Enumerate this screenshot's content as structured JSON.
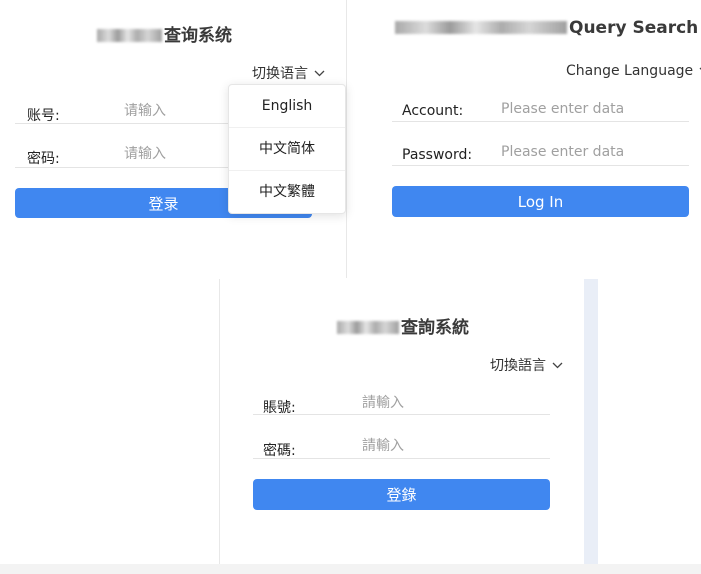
{
  "panel_cn_simplified": {
    "title_visible": "查询系统",
    "language_switch": "切换语言",
    "account_label": "账号:",
    "account_placeholder": "请输入",
    "password_label": "密码:",
    "password_placeholder": "请输入",
    "login_button": "登录",
    "language_menu": [
      "English",
      "中文简体",
      "中文繁體"
    ]
  },
  "panel_english": {
    "title_visible": "Query Search",
    "language_switch": "Change Language",
    "account_label": "Account:",
    "account_placeholder": "Please enter data",
    "password_label": "Password:",
    "password_placeholder": "Please enter data",
    "login_button": "Log In"
  },
  "panel_cn_traditional": {
    "title_visible": "查詢系統",
    "language_switch": "切換語言",
    "account_label": "賬號:",
    "account_placeholder": "請輸入",
    "password_label": "密碼:",
    "password_placeholder": "請輸入",
    "login_button": "登錄"
  },
  "colors": {
    "primary_button": "#4087f0",
    "border": "#e4e4e4",
    "scrollbar": "#e9eef7"
  }
}
